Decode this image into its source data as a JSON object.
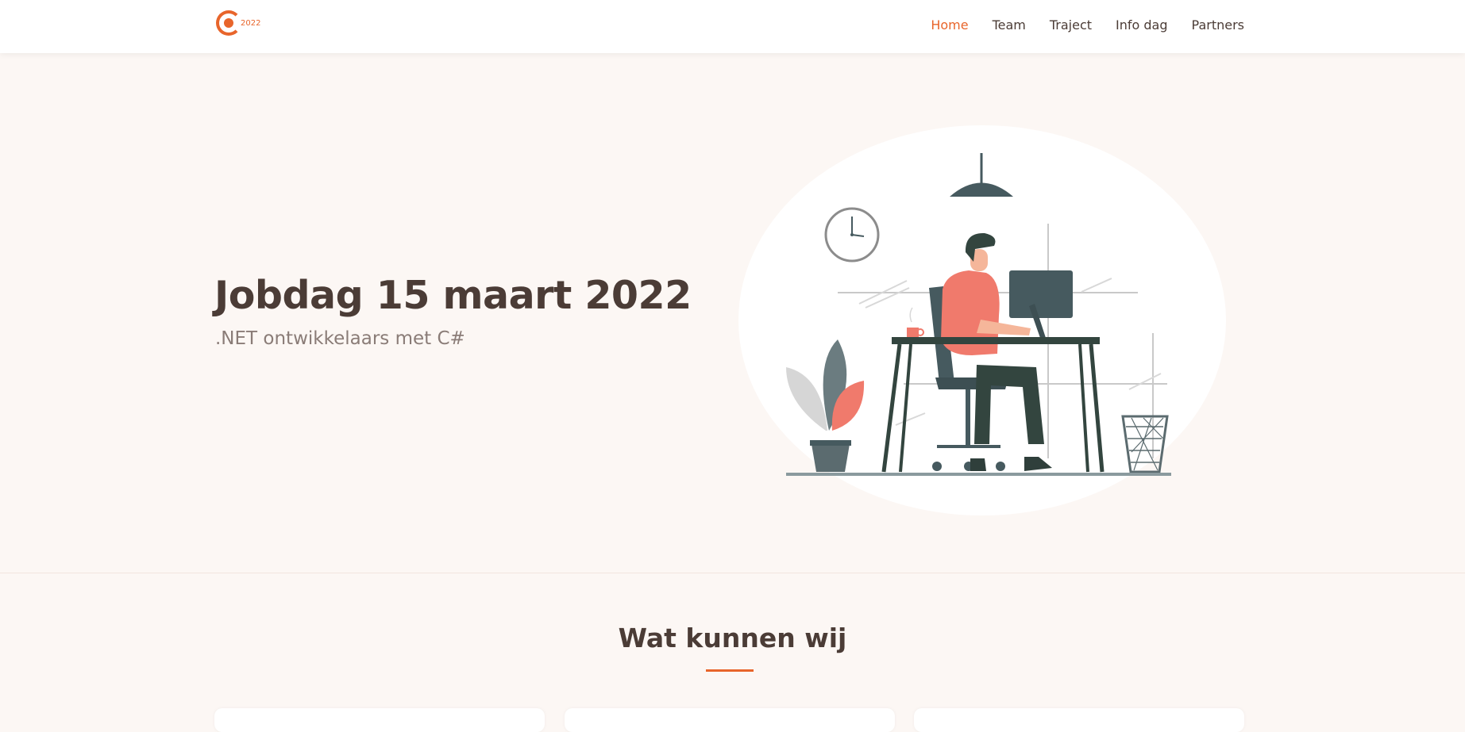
{
  "brand": {
    "logo_text": "2022",
    "accent": "#e8652b"
  },
  "nav": {
    "items": [
      {
        "label": "Home",
        "active": true
      },
      {
        "label": "Team",
        "active": false
      },
      {
        "label": "Traject",
        "active": false
      },
      {
        "label": "Info dag",
        "active": false
      },
      {
        "label": "Partners",
        "active": false
      }
    ]
  },
  "hero": {
    "title": "Jobdag 15 maart 2022",
    "subtitle": ".NET ontwikkelaars met C#",
    "illustration": "person-working-at-computer-illustration"
  },
  "section": {
    "title": "Wat kunnen wij"
  },
  "colors": {
    "background": "#fcf7f4",
    "text": "#4b3c36",
    "muted": "#8a7c77",
    "accent": "#e8652b"
  }
}
